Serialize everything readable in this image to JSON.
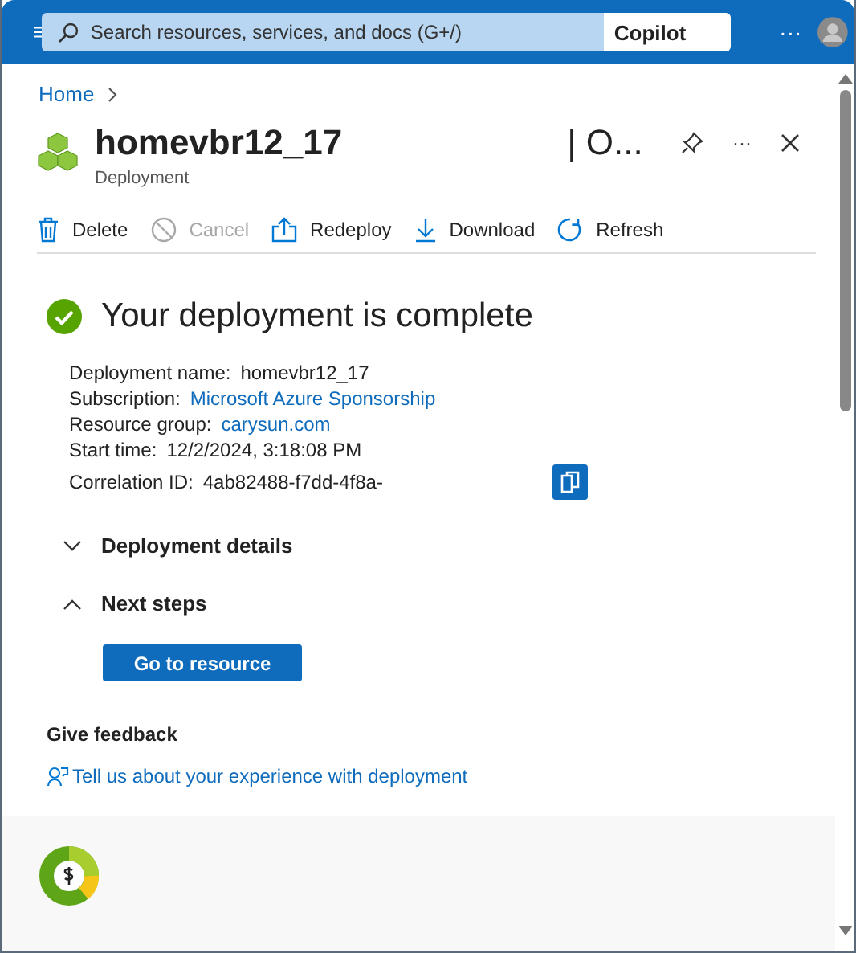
{
  "top_bar": {
    "search_placeholder": "Search resources, services, and docs (G+/)",
    "copilot": "Copilot",
    "more": "···"
  },
  "breadcrumb": [
    {
      "label": "Home"
    }
  ],
  "header": {
    "title": "homevbr12_17",
    "title_suffix": "| O...",
    "subtitle": "Deployment",
    "more": "···"
  },
  "toolbar": [
    {
      "kind": "delete",
      "label": "Delete",
      "disabled": false
    },
    {
      "kind": "cancel",
      "label": "Cancel",
      "disabled": true
    },
    {
      "kind": "redeploy",
      "label": "Redeploy",
      "disabled": false
    },
    {
      "kind": "download",
      "label": "Download",
      "disabled": false
    },
    {
      "kind": "refresh",
      "label": "Refresh",
      "disabled": false
    }
  ],
  "status": {
    "title": "Your deployment is complete"
  },
  "details": [
    {
      "label": "Deployment name:",
      "value": "homevbr12_17",
      "link": false
    },
    {
      "label": "Subscription:",
      "value": "Microsoft Azure Sponsorship",
      "link": true
    },
    {
      "label": "Resource group:",
      "value": "carysun.com",
      "link": true
    },
    {
      "label": "Start time:",
      "value": "12/2/2024, 3:18:08 PM",
      "link": false
    },
    {
      "label": "Correlation ID:",
      "value": "4ab82488-f7dd-4f8a-",
      "link": false
    }
  ],
  "sections": [
    {
      "label": "Deployment details",
      "expanded": false
    },
    {
      "label": "Next steps",
      "expanded": true
    }
  ],
  "primary_button": "Go to resource",
  "feedback": {
    "heading": "Give feedback",
    "link": "Tell us about your experience with deployment"
  }
}
